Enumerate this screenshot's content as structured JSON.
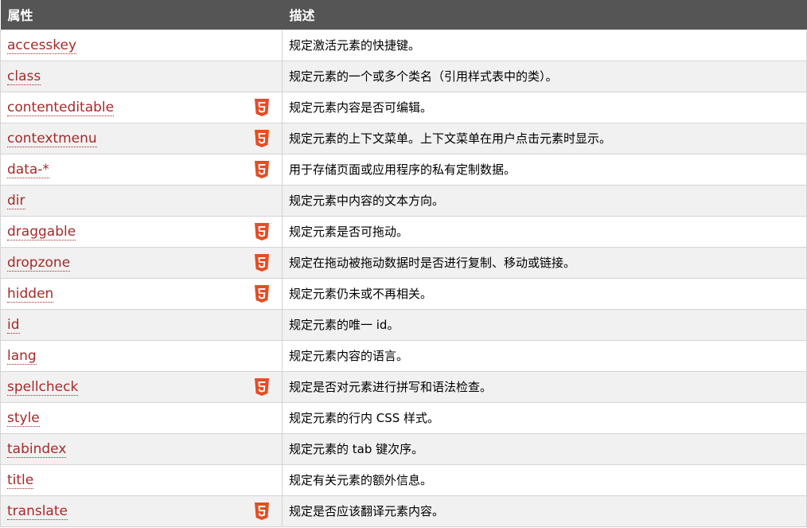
{
  "header": {
    "col_attribute": "属性",
    "col_description": "描述"
  },
  "colors": {
    "header_bg": "#555555",
    "link": "#a52a2a",
    "html5_badge": "#e44d26"
  },
  "rows": [
    {
      "attr": "accesskey",
      "desc": "规定激活元素的快捷键。",
      "html5": false
    },
    {
      "attr": "class",
      "desc": "规定元素的一个或多个类名（引用样式表中的类）。",
      "html5": false
    },
    {
      "attr": "contenteditable",
      "desc": "规定元素内容是否可编辑。",
      "html5": true
    },
    {
      "attr": "contextmenu",
      "desc": "规定元素的上下文菜单。上下文菜单在用户点击元素时显示。",
      "html5": true
    },
    {
      "attr": "data-*",
      "desc": "用于存储页面或应用程序的私有定制数据。",
      "html5": true
    },
    {
      "attr": "dir",
      "desc": "规定元素中内容的文本方向。",
      "html5": false
    },
    {
      "attr": "draggable",
      "desc": "规定元素是否可拖动。",
      "html5": true
    },
    {
      "attr": "dropzone",
      "desc": "规定在拖动被拖动数据时是否进行复制、移动或链接。",
      "html5": true
    },
    {
      "attr": "hidden",
      "desc": "规定元素仍未或不再相关。",
      "html5": true
    },
    {
      "attr": "id",
      "desc": "规定元素的唯一 id。",
      "html5": false
    },
    {
      "attr": "lang",
      "desc": "规定元素内容的语言。",
      "html5": false
    },
    {
      "attr": "spellcheck",
      "desc": "规定是否对元素进行拼写和语法检查。",
      "html5": true
    },
    {
      "attr": "style",
      "desc": "规定元素的行内 CSS 样式。",
      "html5": false
    },
    {
      "attr": "tabindex",
      "desc": "规定元素的 tab 键次序。",
      "html5": false
    },
    {
      "attr": "title",
      "desc": "规定有关元素的额外信息。",
      "html5": false
    },
    {
      "attr": "translate",
      "desc": "规定是否应该翻译元素内容。",
      "html5": true
    }
  ]
}
